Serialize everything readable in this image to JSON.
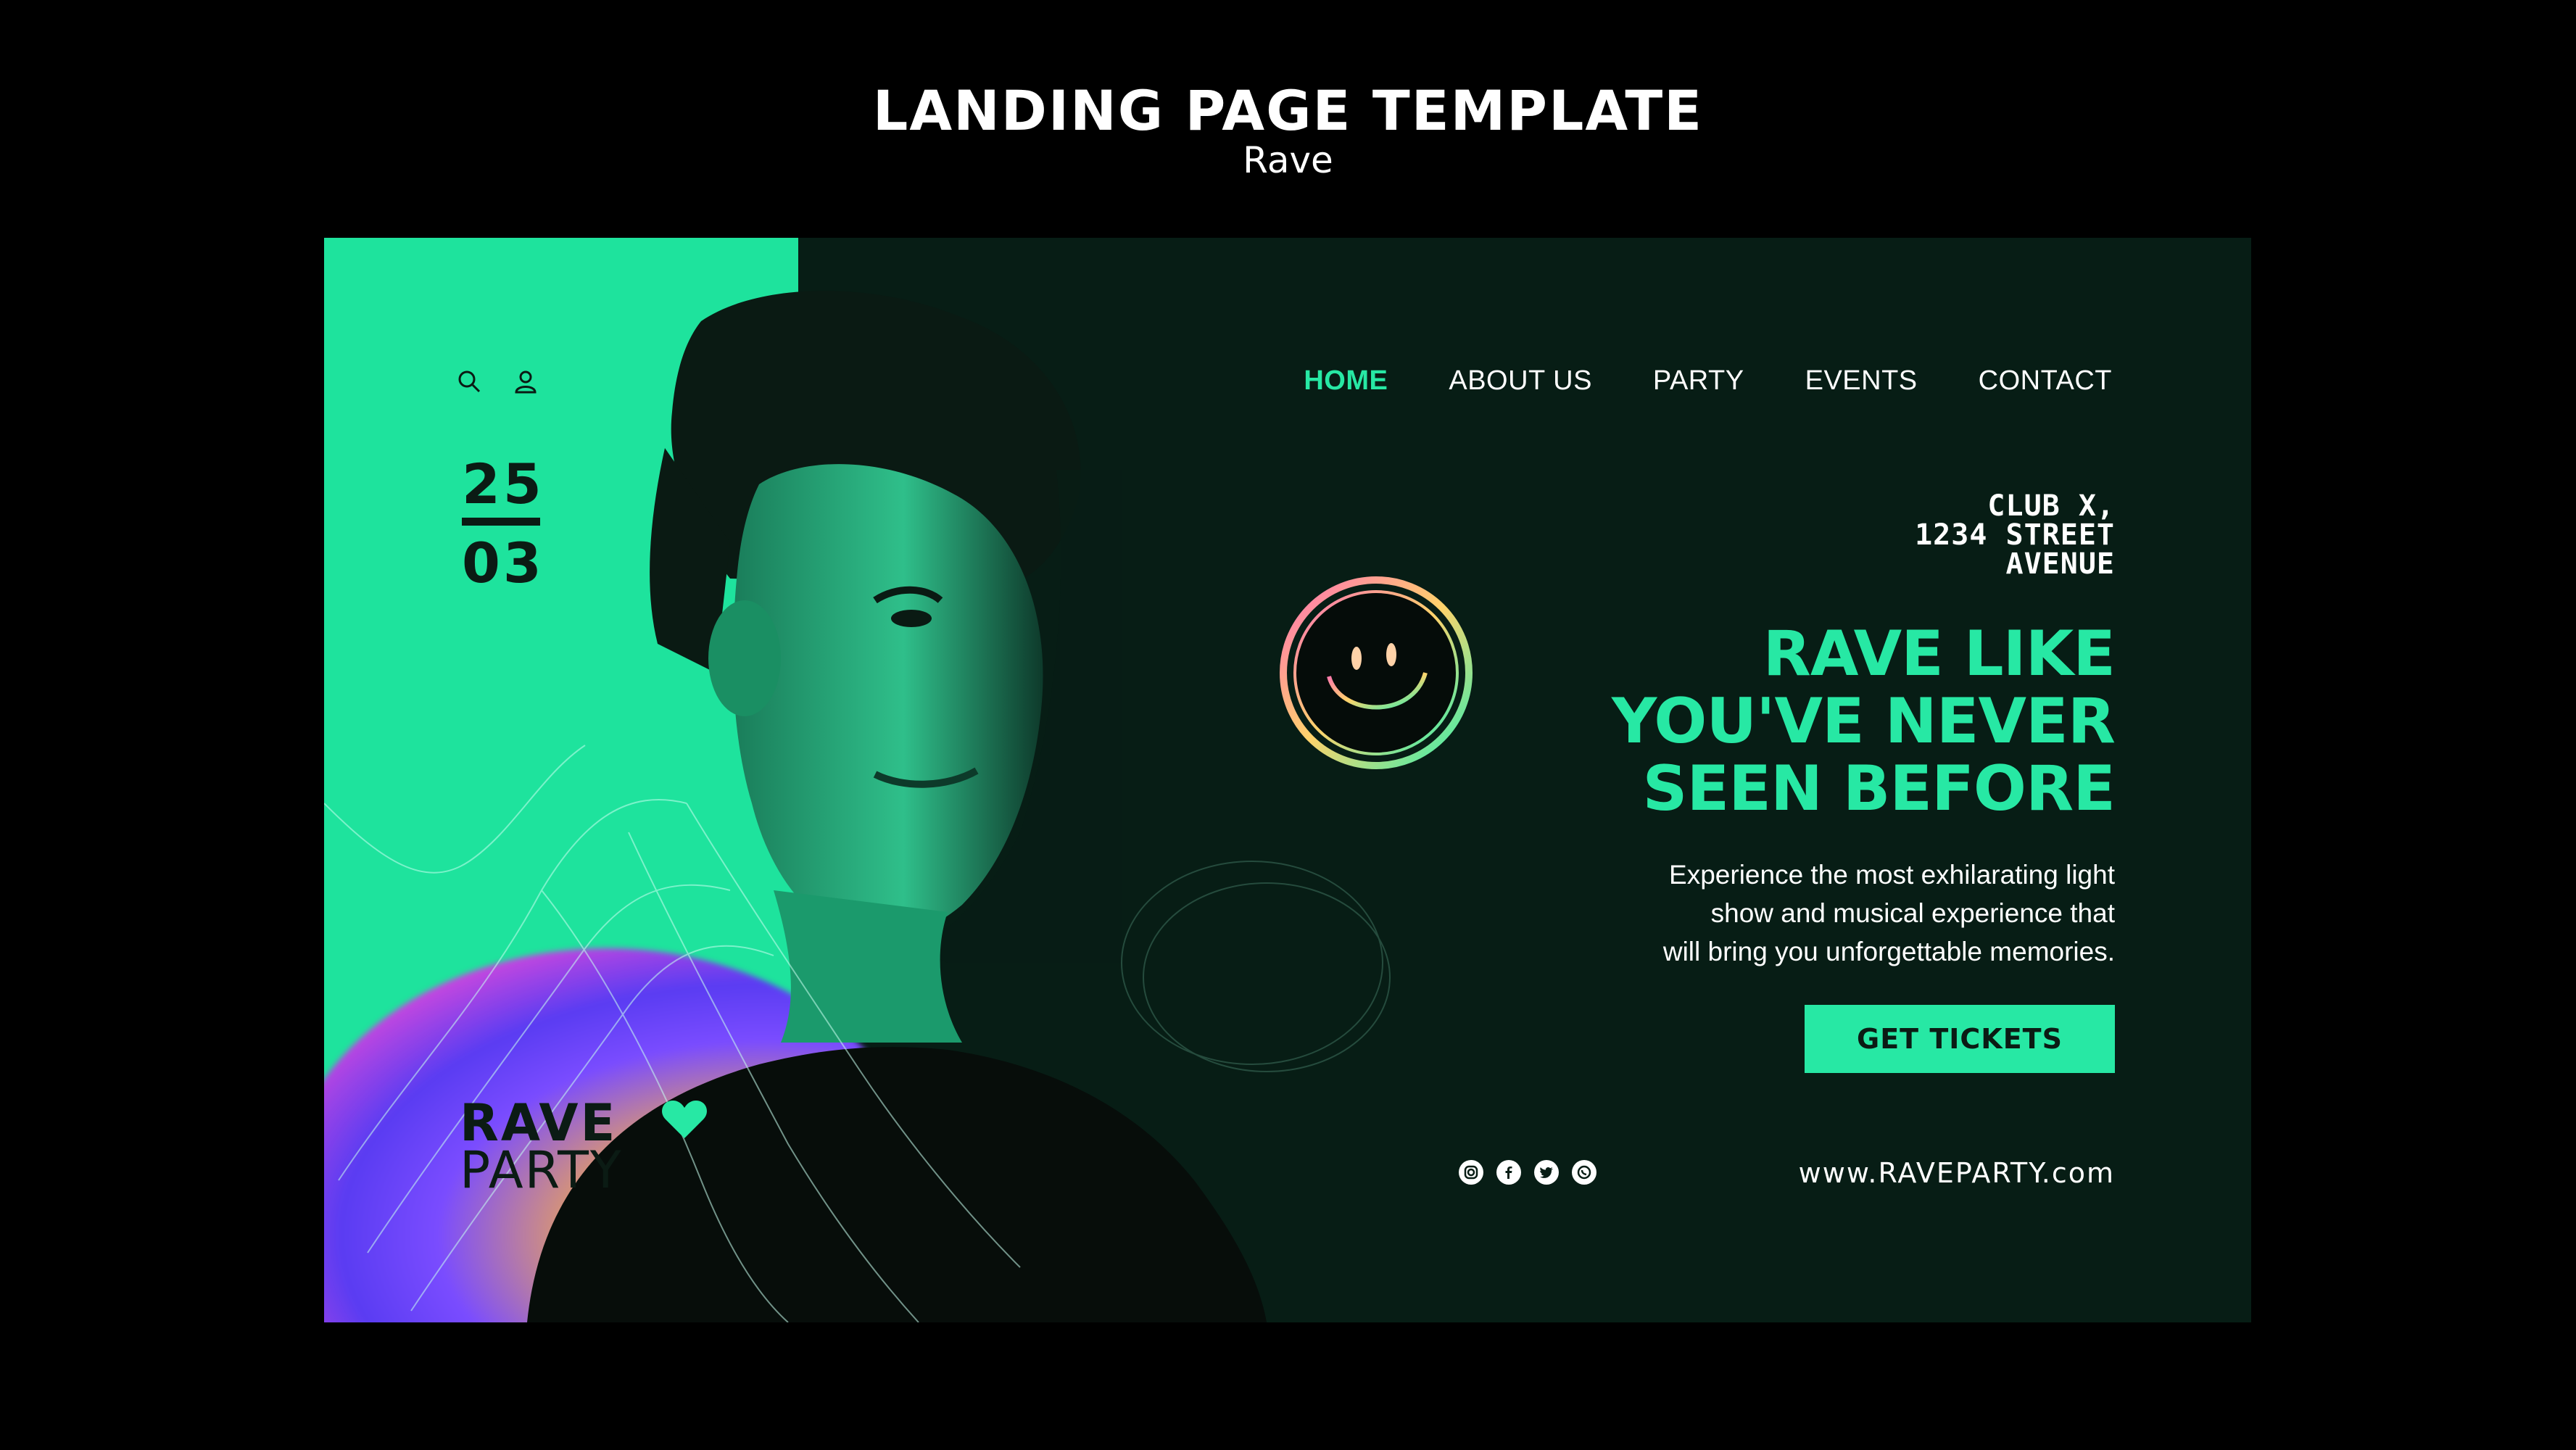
{
  "header": {
    "title": "LANDING PAGE TEMPLATE",
    "subtitle": "Rave"
  },
  "colors": {
    "accent": "#27e8a4",
    "panel_green": "#1ee39d",
    "dark_bg": "#071d15",
    "page_bg": "#000000"
  },
  "icons": {
    "search": "search-icon",
    "user": "user-icon"
  },
  "event_date": {
    "day": "25",
    "month": "03"
  },
  "nav": {
    "items": [
      {
        "label": "HOME",
        "active": true
      },
      {
        "label": "ABOUT US",
        "active": false
      },
      {
        "label": "PARTY",
        "active": false
      },
      {
        "label": "EVENTS",
        "active": false
      },
      {
        "label": "CONTACT",
        "active": false
      }
    ]
  },
  "address": {
    "line1": "CLUB X,",
    "line2": "1234 STREET",
    "line3": "AVENUE"
  },
  "hero": {
    "line1": "RAVE LIKE",
    "line2": "YOU'VE NEVER",
    "line3": "SEEN BEFORE",
    "desc1": "Experience the most exhilarating light",
    "desc2": "show and musical experience that",
    "desc3": "will bring you unforgettable memories.",
    "cta": "GET TICKETS"
  },
  "logo": {
    "line1": "RAVE",
    "line2": "PARTY"
  },
  "socials": [
    "instagram-icon",
    "facebook-icon",
    "twitter-icon",
    "whatsapp-icon"
  ],
  "website": "www.RAVEPARTY.com"
}
